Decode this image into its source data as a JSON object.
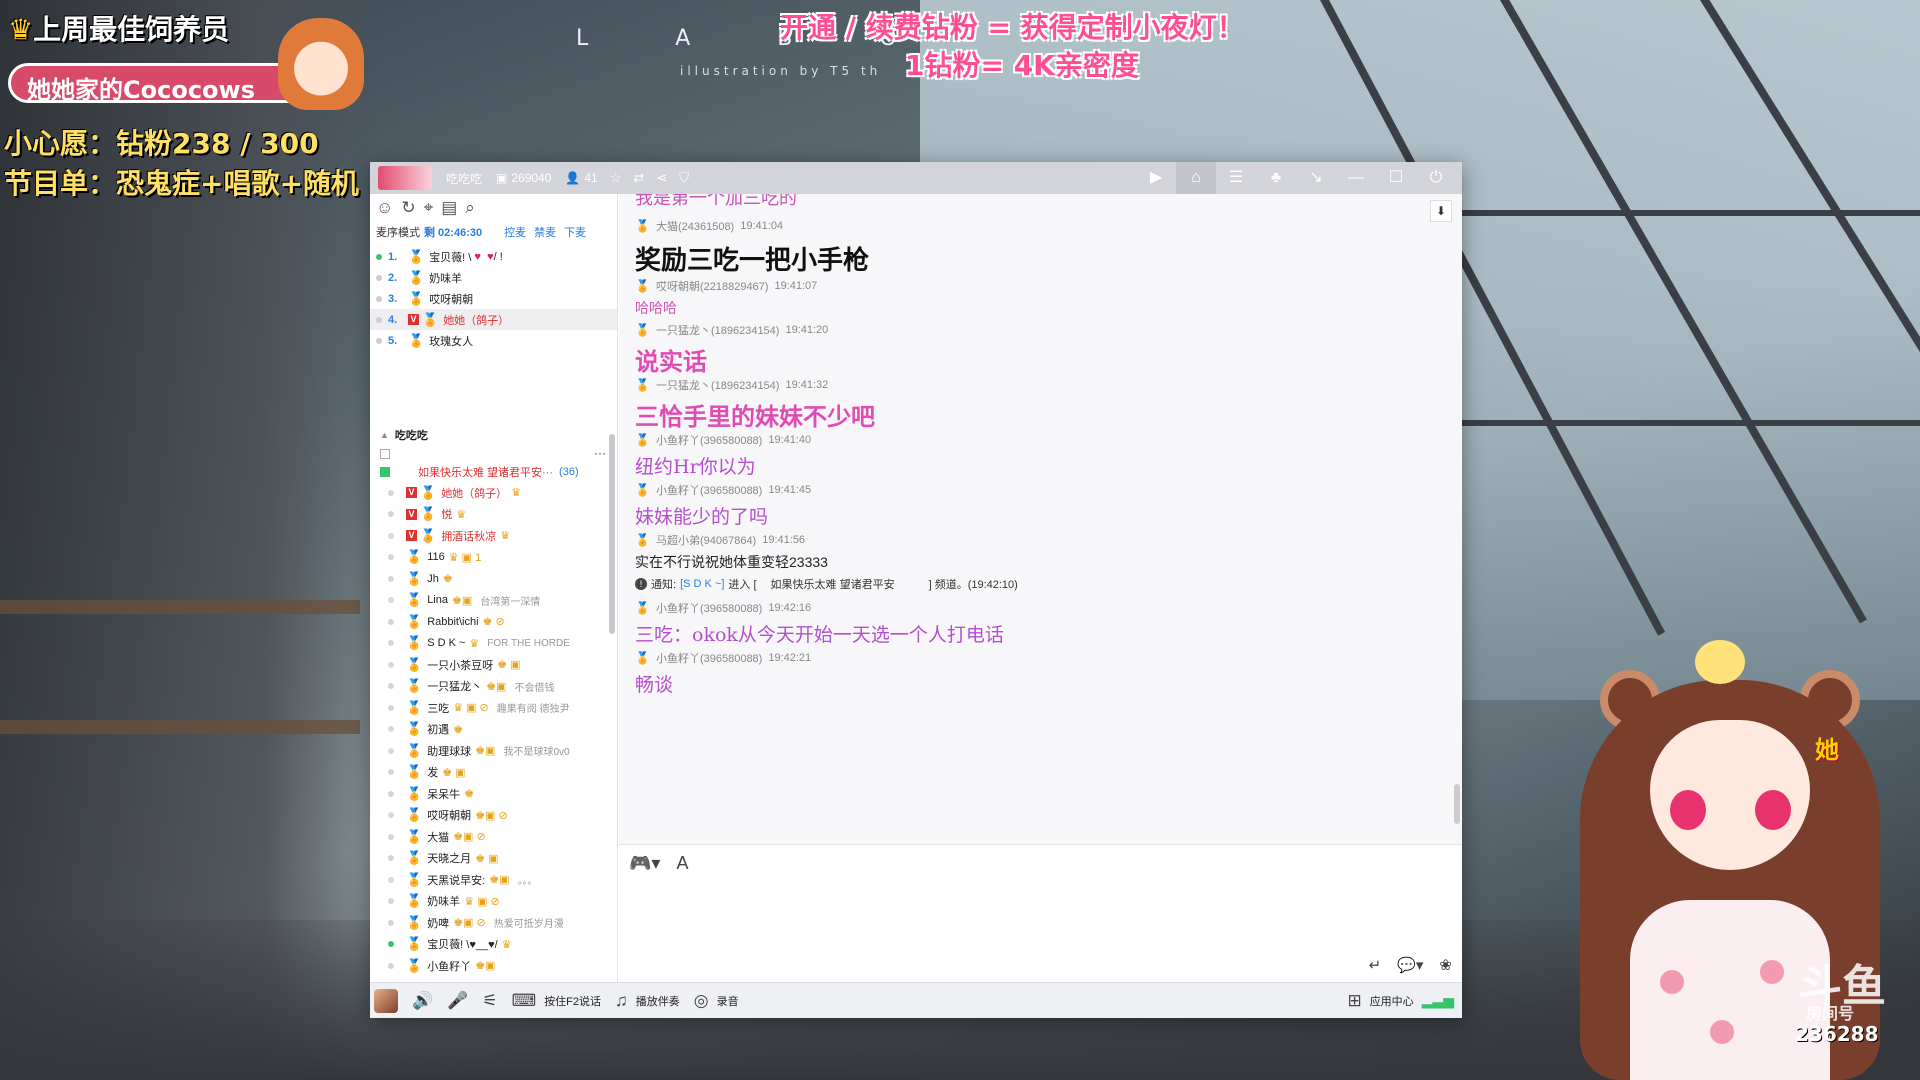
{
  "overlay": {
    "top_feeder_title": "上周最佳饲养员",
    "top_feeder_name": "她她家的Cococows",
    "wish": "小心愿：钻粉238 / 300",
    "program": "节目单：恐鬼症+唱歌+随机",
    "promo_line1": "开通 / 续费钻粉 = 获得定制小夜灯！",
    "promo_line2": "1钻粉= 4K亲密度",
    "labo": "L A B O",
    "illustration": "illustration by T5 th",
    "room_logo": "斗鱼",
    "room_label": "房间号",
    "room_number": "236288",
    "vtuber_badge": "她"
  },
  "titlebar": {
    "channel_name": "吃吃吃",
    "room_id": "269040",
    "online_count": "41"
  },
  "left_panel": {
    "queue_mode_label": "麦序模式",
    "queue_timer": "剩 02:46:30",
    "actions": [
      "控麦",
      "禁麦",
      "下麦"
    ],
    "queue": [
      {
        "num": "1.",
        "name": "宝贝薇! \\",
        "suffix": "/ !",
        "online": true
      },
      {
        "num": "2.",
        "name": "奶味羊",
        "suffix": "",
        "online": false
      },
      {
        "num": "3.",
        "name": "哎呀朝朝",
        "suffix": "",
        "online": false
      },
      {
        "num": "4.",
        "name": "她她（鸽子）",
        "suffix": "",
        "online": false,
        "selected": true,
        "red": true
      },
      {
        "num": "5.",
        "name": "玫瑰女人",
        "suffix": "",
        "online": false
      }
    ],
    "channel_title": "吃吃吃",
    "sub_channel": "如果快乐太难  望诸君平安···",
    "sub_channel_count": "(36)",
    "members": [
      {
        "name": "她她（鸽子）",
        "badges": "♛",
        "sig": "",
        "red": true,
        "v": true
      },
      {
        "name": "悦",
        "badges": "♛",
        "sig": "",
        "red": true,
        "v": true
      },
      {
        "name": "拥酒话秋凉",
        "badges": "♛",
        "sig": "",
        "red": true,
        "v": true
      },
      {
        "name": "116",
        "badges": "♛ ▣ 1",
        "sig": ""
      },
      {
        "name": "Jh",
        "badges": "♚",
        "sig": ""
      },
      {
        "name": "Lina",
        "badges": "♚▣",
        "sig": "台湾第一深情"
      },
      {
        "name": "Rabbit\\ichi",
        "badges": "♚ ⊘",
        "sig": ""
      },
      {
        "name": "S D K ~",
        "badges": "♛",
        "sig": "FOR THE HORDE"
      },
      {
        "name": "一只小茶豆呀",
        "badges": "♚ ▣",
        "sig": ""
      },
      {
        "name": "一只猛龙丶",
        "badges": "♚▣",
        "sig": "不会借钱"
      },
      {
        "name": "三吃",
        "badges": "♛ ▣ ⊘",
        "sig": "趣果有阅  德独尹"
      },
      {
        "name": "初遇",
        "badges": "♚",
        "sig": ""
      },
      {
        "name": "助理球球",
        "badges": "♚▣",
        "sig": "我不是球球0v0"
      },
      {
        "name": "发",
        "badges": "♚ ▣",
        "sig": ""
      },
      {
        "name": "呆呆牛",
        "badges": "♚",
        "sig": ""
      },
      {
        "name": "哎呀朝朝",
        "badges": "♚▣ ⊘",
        "sig": ""
      },
      {
        "name": "大猫",
        "badges": "♚▣ ⊘",
        "sig": ""
      },
      {
        "name": "天晓之月",
        "badges": "♚ ▣",
        "sig": ""
      },
      {
        "name": "天黑说早安:",
        "badges": "♚▣",
        "sig": "。。。"
      },
      {
        "name": "奶味羊",
        "badges": "♛ ▣ ⊘",
        "sig": ""
      },
      {
        "name": "奶啤",
        "badges": "♚▣ ⊘",
        "sig": "热爱可抵岁月漫"
      },
      {
        "name": "宝贝薇! \\♥__♥/",
        "badges": "♛",
        "sig": "",
        "online": true
      },
      {
        "name": "小鱼籽丫",
        "badges": "♚▣",
        "sig": ""
      }
    ]
  },
  "chat": {
    "partial_top": "我是第一个加三吃的",
    "messages": [
      {
        "user": "大猫(24361508)",
        "time": "19:41:04",
        "text": "奖励三吃一把小手枪",
        "style": "black-big"
      },
      {
        "user": "哎呀朝朝(2218829467)",
        "time": "19:41:07",
        "text": "哈哈哈",
        "style": "pink"
      },
      {
        "user": "一只猛龙丶(1896234154)",
        "time": "19:41:20",
        "text": "说实话",
        "style": "pink-big"
      },
      {
        "user": "一只猛龙丶(1896234154)",
        "time": "19:41:32",
        "text": "三恰手里的妹妹不少吧",
        "style": "pink-big"
      },
      {
        "user": "小鱼籽丫(396580088)",
        "time": "19:41:40",
        "text": "纽约Hr你以为",
        "style": "purple"
      },
      {
        "user": "小鱼籽丫(396580088)",
        "time": "19:41:45",
        "text": "妹妹能少的了吗",
        "style": "purple"
      },
      {
        "user": "马超小弟(94067864)",
        "time": "19:41:56",
        "text": "实在不行说祝她体重变轻23333",
        "style": "dark"
      }
    ],
    "notice": {
      "prefix": "通知:",
      "user": "[S D K ~]",
      "action": "进入 [",
      "channel": "如果快乐太难  望诸君平安",
      "suffix": "] 频道。(19:42:10)"
    },
    "messages2": [
      {
        "user": "小鱼籽丫(396580088)",
        "time": "19:42:16",
        "text": "三吃：okok从今天开始一天选一个人打电话",
        "style": "purple"
      },
      {
        "user": "小鱼籽丫(396580088)",
        "time": "19:42:21",
        "text": "畅谈",
        "style": "purple"
      }
    ]
  },
  "bottombar": {
    "push_to_talk": "按住F2说话",
    "play_accompaniment": "播放伴奏",
    "record": "录音",
    "app_center": "应用中心"
  }
}
